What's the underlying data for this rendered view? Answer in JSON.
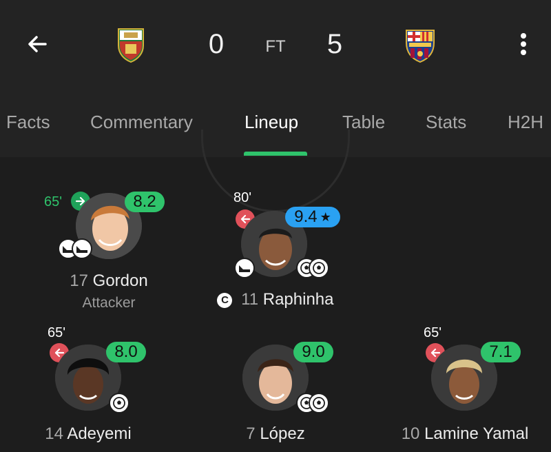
{
  "match": {
    "home_score": "0",
    "away_score": "5",
    "status": "FT"
  },
  "tabs": [
    "Facts",
    "Commentary",
    "Lineup",
    "Table",
    "Stats",
    "H2H"
  ],
  "active_tab": "Lineup",
  "colors": {
    "background": "#1d1d1d",
    "header": "#232323",
    "rating_green": "#2fc36b",
    "rating_blue": "#2aa1f2",
    "sub_in": "#1fa25a",
    "sub_out": "#e0515a"
  },
  "players": {
    "gordon": {
      "number": "17",
      "name": "Gordon",
      "position": "Attacker",
      "rating": "8.2",
      "minute": "65'",
      "sub": "sub-in",
      "events": [
        "boots-icon",
        "boots-icon"
      ]
    },
    "raphinha": {
      "captain_badge": "C",
      "number": "11",
      "name": "Raphinha",
      "rating": "9.4",
      "rating_star": "★",
      "minute": "80'",
      "sub": "sub-out",
      "events": [
        "boot-icon",
        "ball-icon",
        "ball-icon"
      ]
    },
    "adeyemi": {
      "number": "14",
      "name": "Adeyemi",
      "rating": "8.0",
      "minute": "65'",
      "sub": "sub-out",
      "events": [
        "ball-icon"
      ]
    },
    "lopez": {
      "number": "7",
      "name": "López",
      "rating": "9.0",
      "events": [
        "ball-icon",
        "ball-icon"
      ]
    },
    "yamal": {
      "number": "10",
      "name": "Lamine Yamal",
      "rating": "7.1",
      "minute": "65'",
      "sub": "sub-out"
    }
  }
}
